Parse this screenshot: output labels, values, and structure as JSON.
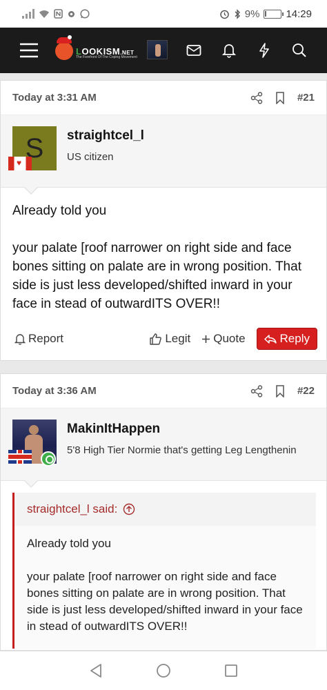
{
  "statusbar": {
    "battery": "9%",
    "battery_level": "9%",
    "time": "14:29"
  },
  "nav": {
    "logo_text_1": "L",
    "logo_text_2": "OOKISM",
    "logo_text_3": ".NET",
    "logo_tagline": "The Forefront Of The Coping Movement"
  },
  "posts": [
    {
      "date": "Today at 3:31 AM",
      "number": "#21",
      "avatar_letter": "S",
      "avatar_color": "#7a7a1e",
      "username": "straightcel_l",
      "user_title": "US citizen",
      "flag": "canada",
      "paragraphs": [
        "Already told you",
        "your palate [roof narrower on right side and face bones sitting on palate are in wrong position. That side is just less developed/shifted inward in your face in stead of outwardITS OVER!!"
      ],
      "actions": {
        "report": "Report",
        "legit": "Legit",
        "quote": "Quote",
        "reply": "Reply"
      }
    },
    {
      "date": "Today at 3:36 AM",
      "number": "#22",
      "username": "MakinItHappen",
      "user_title": "5'8 High Tier Normie that's getting Leg Lengthenin",
      "flag": "united-kingdom",
      "quote": {
        "author": "straightcel_l said:",
        "paragraphs": [
          "Already told you",
          "your palate [roof narrower on right side and face bones sitting on palate are in wrong position. That side is just less developed/shifted inward in your face in stead of outwardITS OVER!!"
        ]
      }
    }
  ],
  "colors": {
    "accent_red": "#d61f1f",
    "quote_border": "#c41d1d",
    "navbar": "#1b1b1b"
  }
}
